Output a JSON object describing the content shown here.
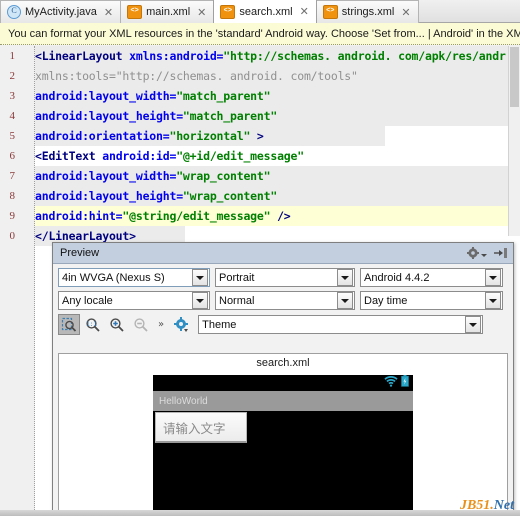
{
  "tabs": [
    {
      "label": "MyActivity.java",
      "icon": "java-class-icon",
      "icon_glyph": "C",
      "active": false,
      "close": "✕"
    },
    {
      "label": "main.xml",
      "icon": "xml-file-icon",
      "icon_glyph": "<>",
      "active": false,
      "close": "✕"
    },
    {
      "label": "search.xml",
      "icon": "xml-file-icon",
      "icon_glyph": "<>",
      "active": true,
      "close": "✕"
    },
    {
      "label": "strings.xml",
      "icon": "xml-file-icon",
      "icon_glyph": "<>",
      "active": false,
      "close": "✕"
    }
  ],
  "banner": {
    "text": "You can format your XML resources in the 'standard' Android way. Choose 'Set from... | Android' in the XM"
  },
  "editor": {
    "line_numbers": [
      "1",
      "2",
      "3",
      "4",
      "5",
      "6",
      "7",
      "8",
      "9",
      "0"
    ],
    "lines": [
      {
        "n": "1",
        "bg": "grey",
        "segs": [
          {
            "t": "<LinearLayout ",
            "c": "tag"
          },
          {
            "t": "xmlns:android=",
            "c": "attr"
          },
          {
            "t": "\"http://schemas. android. com/apk/res/andr",
            "c": "val"
          }
        ]
      },
      {
        "n": "2",
        "bg": "grey",
        "segs": [
          {
            "t": "            ",
            "c": "punct"
          },
          {
            "t": "xmlns:tools=",
            "c": "ns"
          },
          {
            "t": "\"http://schemas. android. com/tools\"",
            "c": "nsval"
          }
        ]
      },
      {
        "n": "3",
        "bg": "grey",
        "segs": [
          {
            "t": "            ",
            "c": "punct"
          },
          {
            "t": "android:layout_width=",
            "c": "attr"
          },
          {
            "t": "\"match_parent\"",
            "c": "val"
          }
        ]
      },
      {
        "n": "4",
        "bg": "grey",
        "segs": [
          {
            "t": "            ",
            "c": "punct"
          },
          {
            "t": "android:layout_height=",
            "c": "attr"
          },
          {
            "t": "\"match_parent\"",
            "c": "val"
          }
        ]
      },
      {
        "n": "5",
        "bg": "grey",
        "segs": [
          {
            "t": "            ",
            "c": "punct"
          },
          {
            "t": "android:orientation=",
            "c": "attr"
          },
          {
            "t": "\"horizontal\"",
            "c": "val"
          },
          {
            "t": " >",
            "c": "tag"
          }
        ]
      },
      {
        "n": "6",
        "bg": "white",
        "segs": [
          {
            "t": "    <EditText ",
            "c": "tag"
          },
          {
            "t": "android:id=",
            "c": "attr"
          },
          {
            "t": "\"@+id/edit_message\"",
            "c": "val"
          }
        ]
      },
      {
        "n": "7",
        "bg": "grey",
        "segs": [
          {
            "t": "            ",
            "c": "punct"
          },
          {
            "t": "android:layout_width=",
            "c": "attr"
          },
          {
            "t": "\"wrap_content\"",
            "c": "val"
          }
        ]
      },
      {
        "n": "8",
        "bg": "grey",
        "segs": [
          {
            "t": "            ",
            "c": "punct"
          },
          {
            "t": "android:layout_height=",
            "c": "attr"
          },
          {
            "t": "\"wrap_content\"",
            "c": "val"
          }
        ]
      },
      {
        "n": "9",
        "bg": "yellow",
        "segs": [
          {
            "t": "            ",
            "c": "punct"
          },
          {
            "t": "android:hint=",
            "c": "attr"
          },
          {
            "t": "\"@string/edit_message\"",
            "c": "val"
          },
          {
            "t": " />",
            "c": "tag"
          }
        ]
      },
      {
        "n": "0",
        "bg": "grey",
        "segs": [
          {
            "t": "</LinearLayout>",
            "c": "tag"
          }
        ]
      }
    ]
  },
  "preview": {
    "title": "Preview",
    "gear_icon": "gear-icon",
    "collapse_icon": "collapse-right-icon",
    "device": {
      "value": "4in WVGA (Nexus S)"
    },
    "orientation": {
      "value": "Portrait"
    },
    "api": {
      "value": "Android 4.4.2"
    },
    "locale": {
      "value": "Any locale"
    },
    "night": {
      "value": "Normal"
    },
    "daytime": {
      "value": "Day time"
    },
    "theme": {
      "value": "Theme"
    },
    "toolbar_icons": [
      {
        "name": "zoom-to-fit-icon",
        "pressed": true
      },
      {
        "name": "zoom-actual-size-icon",
        "pressed": false
      },
      {
        "name": "zoom-in-icon",
        "pressed": false
      },
      {
        "name": "zoom-out-icon",
        "pressed": false
      }
    ],
    "overflow_label": "»",
    "toolbar_gear_icon": "gear-dropdown-icon",
    "canvas": {
      "filename": "search.xml",
      "statusbar": {
        "wifi_icon": "wifi-icon",
        "battery_icon": "battery-icon"
      },
      "app_title": "HelloWorld",
      "edit_text_hint": "请输入文字"
    }
  },
  "watermark": {
    "part1": "JB51.",
    "part2": "Net"
  },
  "colors": {
    "tag": "#000080",
    "attribute": "#0000ee",
    "value": "#008000",
    "banner_bg": "#fbfbd6",
    "highlight_line": "#ffffd5",
    "panel_header": "#c3cfdf",
    "watermark_orange": "#e8901a",
    "watermark_blue": "#2f6fad"
  }
}
